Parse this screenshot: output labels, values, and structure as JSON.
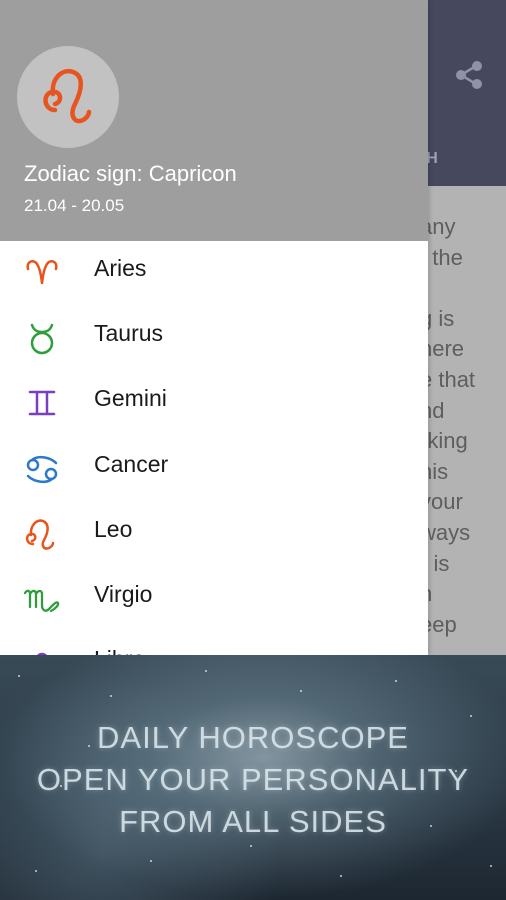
{
  "background": {
    "tab_label": "ITH",
    "text_lines": [
      "any",
      "f the",
      "",
      "g is",
      "here",
      "e that",
      "nd",
      "rking",
      "his",
      " your",
      "ways",
      "r is",
      "n",
      "eep"
    ]
  },
  "drawer": {
    "header": {
      "title": "Zodiac sign: Capricon",
      "dates": "21.04 - 20.05",
      "avatar_icon": "leo-icon"
    },
    "signs": [
      {
        "label": "Aries",
        "icon": "aries-icon",
        "color": "#e8541d"
      },
      {
        "label": "Taurus",
        "icon": "taurus-icon",
        "color": "#2e9e3a"
      },
      {
        "label": "Gemini",
        "icon": "gemini-icon",
        "color": "#7a3fc0"
      },
      {
        "label": "Cancer",
        "icon": "cancer-icon",
        "color": "#2b79c9"
      },
      {
        "label": "Leo",
        "icon": "leo-icon",
        "color": "#e8541d"
      },
      {
        "label": "Virgio",
        "icon": "virgo-icon",
        "color": "#2e9e3a"
      },
      {
        "label": "Libra",
        "icon": "libra-icon",
        "color": "#7a3fc0"
      }
    ]
  },
  "banner": {
    "lines": [
      "DAILY HOROSCOPE",
      "OPEN YOUR PERSONALITY",
      "FROM ALL SIDES"
    ]
  },
  "colors": {
    "app_bar": "#46485e",
    "drawer_header": "#9e9e9e",
    "leo_orange": "#e8541d"
  }
}
